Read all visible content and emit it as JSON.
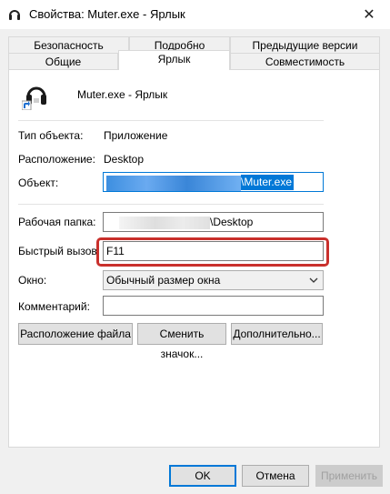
{
  "window": {
    "title": "Свойства: Muter.exe - Ярлык",
    "close_symbol": "✕"
  },
  "tabs_row1": [
    "Безопасность",
    "Подробно",
    "Предыдущие версии"
  ],
  "tabs_row2": [
    "Общие",
    "Ярлык",
    "Совместимость"
  ],
  "active_tab": "Ярлык",
  "shortcut": {
    "name": "Muter.exe - Ярлык",
    "type_label": "Тип объекта:",
    "type_value": "Приложение",
    "location_label": "Расположение:",
    "location_value": "Desktop",
    "target_label": "Объект:",
    "target_value_suffix": "\\Muter.exe",
    "startin_label": "Рабочая папка:",
    "startin_value_suffix": "\\Desktop",
    "hotkey_label": "Быстрый вызов:",
    "hotkey_value": "F11",
    "window_label": "Окно:",
    "window_value": "Обычный размер окна",
    "comment_label": "Комментарий:",
    "comment_value": ""
  },
  "buttons": {
    "open_location": "Расположение файла",
    "change_icon": "Сменить значок...",
    "advanced": "Дополнительно...",
    "ok": "OK",
    "cancel": "Отмена",
    "apply": "Применить"
  },
  "colors": {
    "selection": "#0078d7",
    "highlight": "#c9302c"
  }
}
